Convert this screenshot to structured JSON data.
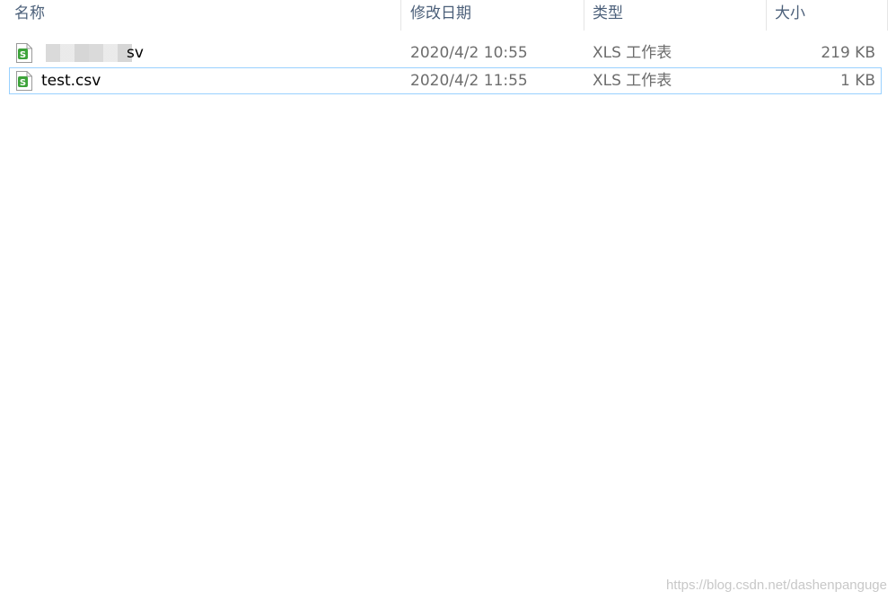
{
  "columns": {
    "name": "名称",
    "date": "修改日期",
    "type": "类型",
    "size": "大小"
  },
  "files": [
    {
      "name": "sv",
      "date": "2020/4/2 10:55",
      "type": "XLS 工作表",
      "size": "219 KB",
      "icon": "spreadsheet-file-icon",
      "selected": false
    },
    {
      "name": "test.csv",
      "date": "2020/4/2 11:55",
      "type": "XLS 工作表",
      "size": "1 KB",
      "icon": "spreadsheet-file-icon",
      "selected": true
    }
  ],
  "colors": {
    "header_text": "#4c607a",
    "selection_border": "#99d1ff",
    "icon_green": "#3da33a"
  },
  "watermark": "https://blog.csdn.net/dashenpanguge"
}
